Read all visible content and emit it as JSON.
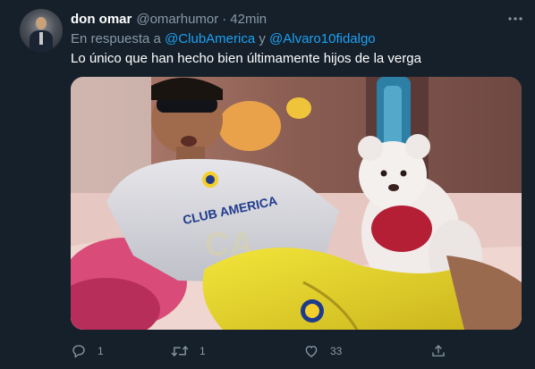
{
  "tweet": {
    "author_name": "don omar",
    "author_handle": "@omarhumor",
    "separator": "·",
    "time": "42min",
    "reply_prefix": "En respuesta a",
    "reply_mention_1": "@ClubAmerica",
    "reply_conjunction": "y",
    "reply_mention_2": "@Alvaro10fidalgo",
    "text": "Lo único que han hecho bien últimamente hijos de la verga",
    "media_text": "CLUB AMERICA"
  },
  "actions": {
    "reply_count": "1",
    "retweet_count": "1",
    "like_count": "33",
    "share_count": ""
  },
  "icons": {
    "more": "more-dots-icon",
    "reply": "reply-icon",
    "retweet": "retweet-icon",
    "like": "heart-icon",
    "share": "share-icon"
  },
  "colors": {
    "background": "#15202b",
    "secondary_text": "#8899a6",
    "link": "#1da1f2"
  }
}
